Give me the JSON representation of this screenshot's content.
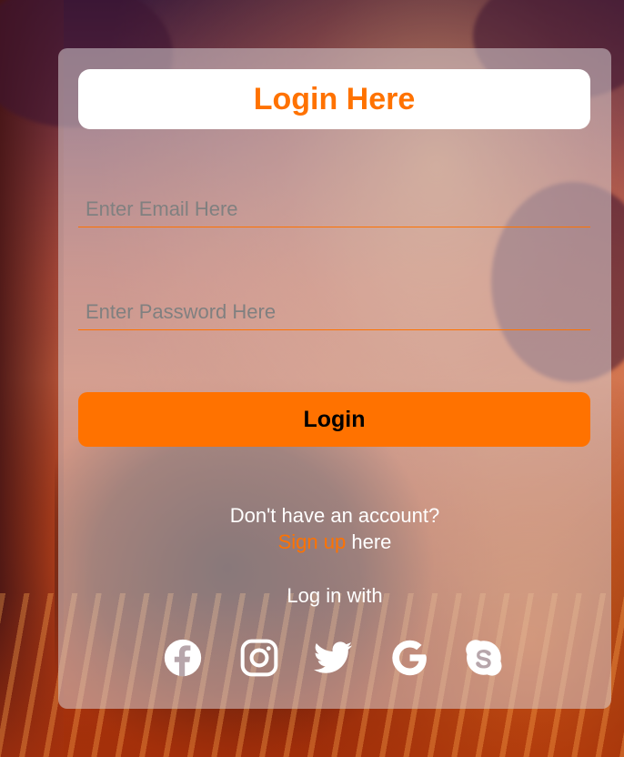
{
  "login_form": {
    "title": "Login Here",
    "email_placeholder": "Enter Email Here",
    "password_placeholder": "Enter Password Here",
    "login_button_label": "Login",
    "no_account_text": "Don't have an account?",
    "signup_link_label": "Sign up",
    "signup_suffix": " here",
    "login_with_label": "Log in with"
  },
  "social_icons": [
    "facebook-icon",
    "instagram-icon",
    "twitter-icon",
    "google-icon",
    "skype-icon"
  ],
  "colors": {
    "accent": "#ff7200",
    "text_light": "#ffffff",
    "title_bg": "#ffffff"
  }
}
